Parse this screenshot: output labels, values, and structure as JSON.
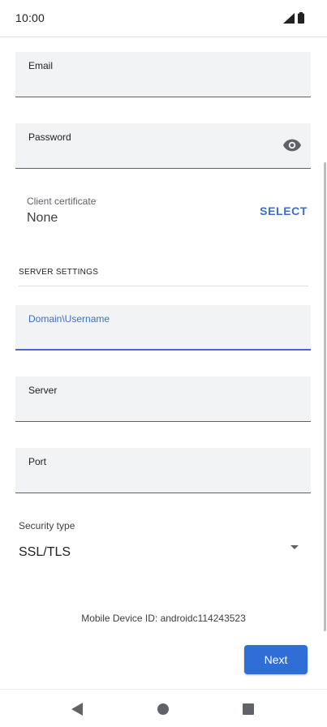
{
  "status_bar": {
    "time": "10:00"
  },
  "form": {
    "email": {
      "label": "Email",
      "value": ""
    },
    "password": {
      "label": "Password",
      "value": ""
    },
    "client_certificate": {
      "label": "Client certificate",
      "value": "None",
      "select_label": "SELECT"
    },
    "server_settings": {
      "section_title": "SERVER SETTINGS",
      "domain_username": {
        "label": "Domain\\Username",
        "value": ""
      },
      "server": {
        "label": "Server",
        "value": ""
      },
      "port": {
        "label": "Port",
        "value": ""
      }
    },
    "security_type": {
      "label": "Security type",
      "value": "SSL/TLS"
    }
  },
  "device_id": "Mobile Device ID: androidc114243523",
  "next_label": "Next",
  "colors": {
    "accent": "#2f6ed7",
    "field_bg": "#f1f3f4",
    "focus": "#3a6fd0"
  },
  "icons": [
    "signal-icon",
    "battery-icon",
    "eye-icon",
    "dropdown-arrow-icon",
    "back-icon",
    "home-icon",
    "recents-icon"
  ]
}
